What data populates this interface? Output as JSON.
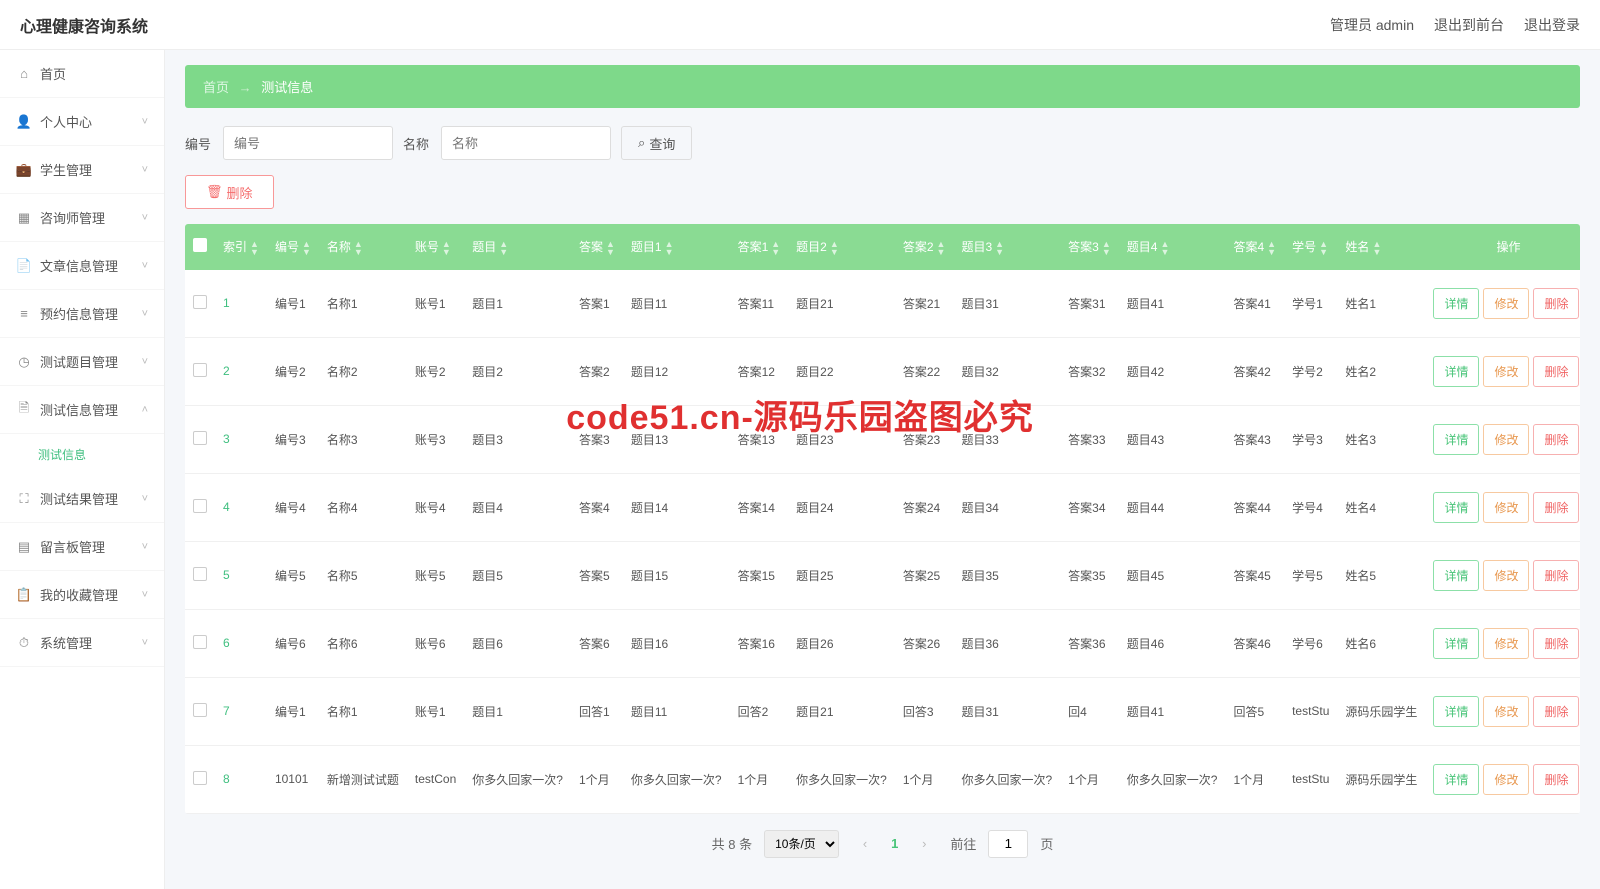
{
  "header": {
    "title": "心理健康咨询系统",
    "links": {
      "admin": "管理员 admin",
      "front": "退出到前台",
      "logout": "退出登录"
    }
  },
  "sidebar": {
    "items": [
      {
        "icon": "home",
        "label": "首页",
        "expandable": false
      },
      {
        "icon": "user",
        "label": "个人中心",
        "expandable": true
      },
      {
        "icon": "briefcase",
        "label": "学生管理",
        "expandable": true
      },
      {
        "icon": "grid",
        "label": "咨询师管理",
        "expandable": true
      },
      {
        "icon": "file",
        "label": "文章信息管理",
        "expandable": true
      },
      {
        "icon": "list",
        "label": "预约信息管理",
        "expandable": true
      },
      {
        "icon": "clock",
        "label": "测试题目管理",
        "expandable": true
      },
      {
        "icon": "page",
        "label": "测试信息管理",
        "expandable": true
      },
      {
        "icon": "scan",
        "label": "测试结果管理",
        "expandable": true
      },
      {
        "icon": "board",
        "label": "留言板管理",
        "expandable": true
      },
      {
        "icon": "folder",
        "label": "我的收藏管理",
        "expandable": true
      },
      {
        "icon": "gear",
        "label": "系统管理",
        "expandable": true
      }
    ],
    "subItem": "测试信息"
  },
  "breadcrumb": {
    "home": "首页",
    "current": "测试信息"
  },
  "search": {
    "field1Label": "编号",
    "field1Placeholder": "编号",
    "field2Label": "名称",
    "field2Placeholder": "名称",
    "queryBtn": "查询"
  },
  "deleteBtn": "删除",
  "table": {
    "headers": [
      "索引",
      "编号",
      "名称",
      "账号",
      "题目",
      "答案",
      "题目1",
      "答案1",
      "题目2",
      "答案2",
      "题目3",
      "答案3",
      "题目4",
      "答案4",
      "学号",
      "姓名",
      "操作"
    ],
    "actions": {
      "detail": "详情",
      "edit": "修改",
      "delete": "删除"
    },
    "rows": [
      {
        "idx": "1",
        "c": [
          "编号1",
          "名称1",
          "账号1",
          "题目1",
          "答案1",
          "题目11",
          "答案11",
          "题目21",
          "答案21",
          "题目31",
          "答案31",
          "题目41",
          "答案41",
          "学号1",
          "姓名1"
        ]
      },
      {
        "idx": "2",
        "c": [
          "编号2",
          "名称2",
          "账号2",
          "题目2",
          "答案2",
          "题目12",
          "答案12",
          "题目22",
          "答案22",
          "题目32",
          "答案32",
          "题目42",
          "答案42",
          "学号2",
          "姓名2"
        ]
      },
      {
        "idx": "3",
        "c": [
          "编号3",
          "名称3",
          "账号3",
          "题目3",
          "答案3",
          "题目13",
          "答案13",
          "题目23",
          "答案23",
          "题目33",
          "答案33",
          "题目43",
          "答案43",
          "学号3",
          "姓名3"
        ]
      },
      {
        "idx": "4",
        "c": [
          "编号4",
          "名称4",
          "账号4",
          "题目4",
          "答案4",
          "题目14",
          "答案14",
          "题目24",
          "答案24",
          "题目34",
          "答案34",
          "题目44",
          "答案44",
          "学号4",
          "姓名4"
        ]
      },
      {
        "idx": "5",
        "c": [
          "编号5",
          "名称5",
          "账号5",
          "题目5",
          "答案5",
          "题目15",
          "答案15",
          "题目25",
          "答案25",
          "题目35",
          "答案35",
          "题目45",
          "答案45",
          "学号5",
          "姓名5"
        ]
      },
      {
        "idx": "6",
        "c": [
          "编号6",
          "名称6",
          "账号6",
          "题目6",
          "答案6",
          "题目16",
          "答案16",
          "题目26",
          "答案26",
          "题目36",
          "答案36",
          "题目46",
          "答案46",
          "学号6",
          "姓名6"
        ]
      },
      {
        "idx": "7",
        "c": [
          "编号1",
          "名称1",
          "账号1",
          "题目1",
          "回答1",
          "题目11",
          "回答2",
          "题目21",
          "回答3",
          "题目31",
          "回4",
          "题目41",
          "回答5",
          "testStu",
          "源码乐园学生"
        ]
      },
      {
        "idx": "8",
        "c": [
          "10101",
          "新增测试试题",
          "testCon",
          "你多久回家一次?",
          "1个月",
          "你多久回家一次?",
          "1个月",
          "你多久回家一次?",
          "1个月",
          "你多久回家一次?",
          "1个月",
          "你多久回家一次?",
          "1个月",
          "testStu",
          "源码乐园学生"
        ]
      }
    ]
  },
  "pagination": {
    "total": "共 8 条",
    "perPage": "10条/页",
    "current": "1",
    "jumpLabel1": "前往",
    "jumpValue": "1",
    "jumpLabel2": "页"
  },
  "watermark": "code51.cn-源码乐园盗图必究"
}
